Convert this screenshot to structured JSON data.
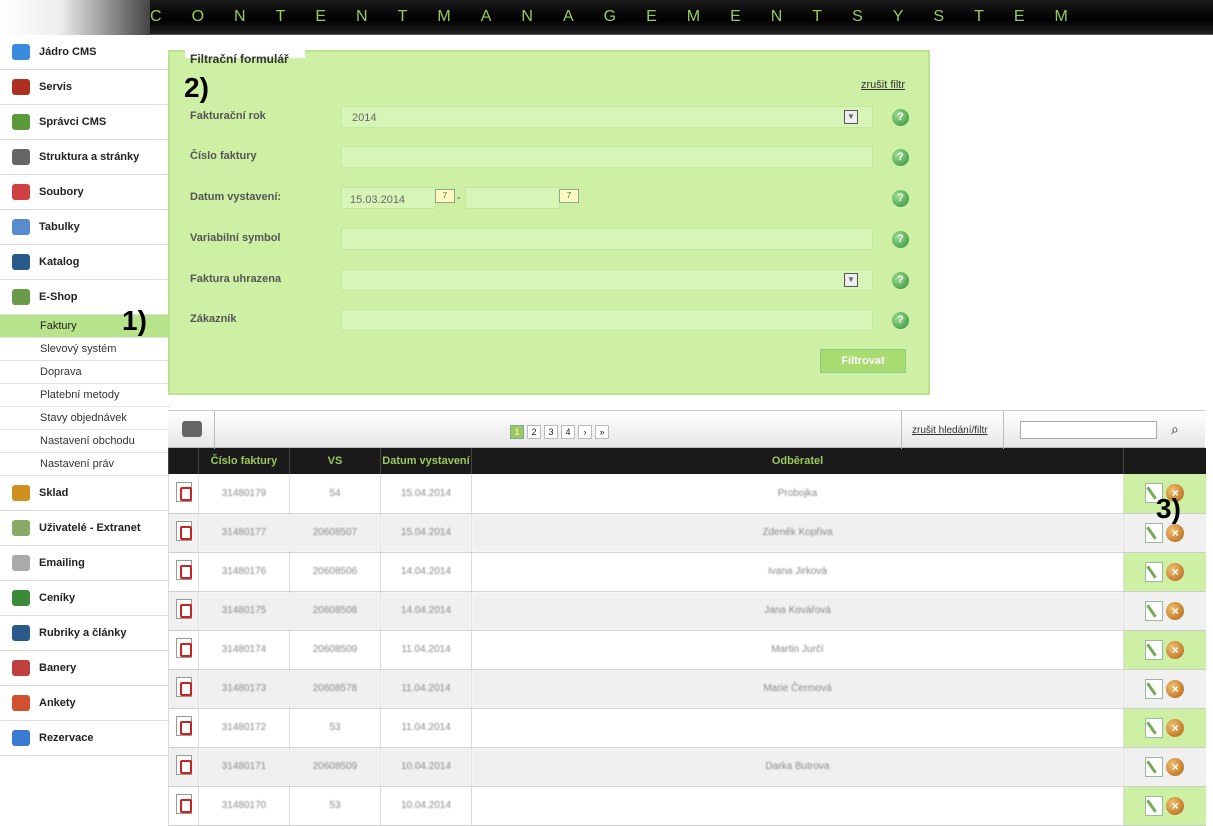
{
  "header": {
    "title_letters": [
      "C",
      "O",
      "N",
      "T",
      "E",
      "N",
      "T",
      "M",
      "A",
      "N",
      "A",
      "G",
      "E",
      "M",
      "E",
      "N",
      "T",
      "S",
      "Y",
      "S",
      "T",
      "E",
      "M"
    ]
  },
  "sidebar": {
    "items_top": [
      {
        "label": "Jádro CMS",
        "icon": "diamond-icon",
        "color": "#3a8ae0"
      },
      {
        "label": "Servis",
        "icon": "hammer-icon",
        "color": "#b03020"
      },
      {
        "label": "Správci CMS",
        "icon": "users-icon",
        "color": "#5a9a3a"
      },
      {
        "label": "Struktura a stránky",
        "icon": "structure-icon",
        "color": "#666"
      },
      {
        "label": "Soubory",
        "icon": "files-icon",
        "color": "#d04040"
      },
      {
        "label": "Tabulky",
        "icon": "table-icon",
        "color": "#5a8ad0"
      },
      {
        "label": "Katalog",
        "icon": "catalog-icon",
        "color": "#2a5a8a"
      },
      {
        "label": "E-Shop",
        "icon": "shop-icon",
        "color": "#6a9a4a"
      }
    ],
    "subitems": [
      "Faktury",
      "Slevový systém",
      "Doprava",
      "Platební metody",
      "Stavy objednávek",
      "Nastavení obchodu",
      "Nastavení práv"
    ],
    "items_bottom": [
      {
        "label": "Sklad",
        "icon": "box-icon",
        "color": "#d09020"
      },
      {
        "label": "Uživatelé - Extranet",
        "icon": "users-icon",
        "color": "#8a6"
      },
      {
        "label": "Emailing",
        "icon": "mail-icon",
        "color": "#aaa"
      },
      {
        "label": "Ceníky",
        "icon": "pricelist-icon",
        "color": "#3a8a3a"
      },
      {
        "label": "Rubriky a články",
        "icon": "articles-icon",
        "color": "#2a5a8a"
      },
      {
        "label": "Banery",
        "icon": "banner-icon",
        "color": "#c04040"
      },
      {
        "label": "Ankety",
        "icon": "poll-icon",
        "color": "#d05030"
      },
      {
        "label": "Rezervace",
        "icon": "calendar-icon",
        "color": "#3a7ad0"
      }
    ]
  },
  "callouts": {
    "one": "1)",
    "two": "2)",
    "three": "3)"
  },
  "filter": {
    "legend": "Filtrační formulář",
    "clear": "zrušit filtr",
    "year_label": "Fakturační rok",
    "year_value": "2014",
    "number_label": "Číslo faktury",
    "number_value": "",
    "date_label": "Datum vystavení:",
    "date_from": "15.03.2014",
    "date_sep": "-",
    "date_to": "",
    "vs_label": "Variabilní symbol",
    "vs_value": "",
    "paid_label": "Faktura uhrazena",
    "paid_value": "",
    "customer_label": "Zákazník",
    "customer_value": "",
    "button": "Filtrovat"
  },
  "grid": {
    "pages": [
      "1",
      "2",
      "3",
      "4",
      "›",
      "»"
    ],
    "clear": "zrušit hledání/filtr",
    "search_value": "",
    "columns": [
      "",
      "Číslo faktury",
      "VS",
      "Datum vystavení",
      "Odběratel",
      ""
    ],
    "rows": [
      {
        "number": "31480179",
        "vs": "54",
        "date": "15.04.2014",
        "customer": "Probojka"
      },
      {
        "number": "31480177",
        "vs": "20608507",
        "date": "15.04.2014",
        "customer": "Zdeněk Kopřiva"
      },
      {
        "number": "31480176",
        "vs": "20608506",
        "date": "14.04.2014",
        "customer": "Ivana Jirková"
      },
      {
        "number": "31480175",
        "vs": "20608508",
        "date": "14.04.2014",
        "customer": "Jana Kovářová"
      },
      {
        "number": "31480174",
        "vs": "20608509",
        "date": "11.04.2014",
        "customer": "Martin Jurčí"
      },
      {
        "number": "31480173",
        "vs": "20608578",
        "date": "11.04.2014",
        "customer": "Marie Čermová"
      },
      {
        "number": "31480172",
        "vs": "53",
        "date": "11.04.2014",
        "customer": ""
      },
      {
        "number": "31480171",
        "vs": "20608509",
        "date": "10.04.2014",
        "customer": "Darka Butrova"
      },
      {
        "number": "31480170",
        "vs": "53",
        "date": "10.04.2014",
        "customer": ""
      }
    ]
  }
}
